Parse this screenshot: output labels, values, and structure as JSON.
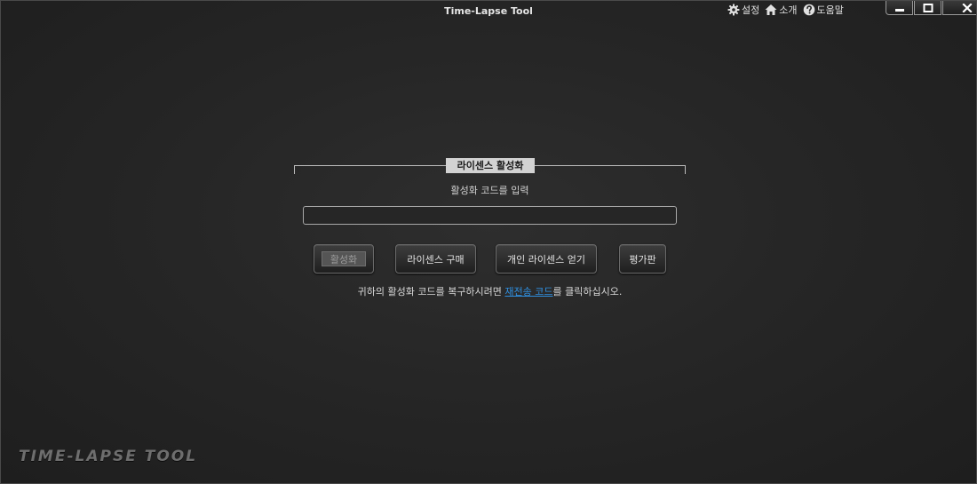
{
  "window": {
    "title": "Time-Lapse Tool"
  },
  "top_links": [
    {
      "label": "설정",
      "icon": "gear-icon"
    },
    {
      "label": "소개",
      "icon": "home-icon"
    },
    {
      "label": "도움말",
      "icon": "help-icon"
    }
  ],
  "window_controls": {
    "minimize_icon": "minimize-icon",
    "maximize_icon": "maximize-icon",
    "close_icon": "close-icon"
  },
  "license": {
    "legend": "라이센스 활성화",
    "prompt": "활성화 코드를 입력",
    "code_value": "",
    "buttons": {
      "activate": "활성화",
      "buy": "라이센스 구매",
      "personal": "개인 라이센스 얻기",
      "trial": "평가판"
    },
    "recover_prefix": "귀하의 활성화 코드를 복구하시려면 ",
    "recover_link": "재전송 코드",
    "recover_suffix": "를 클릭하십시오."
  },
  "brand": {
    "logo_text": "TIME-LAPSE TOOL"
  },
  "colors": {
    "background": "#262626",
    "link": "#2f8fe0",
    "legend_bg": "#d2d2d2"
  }
}
